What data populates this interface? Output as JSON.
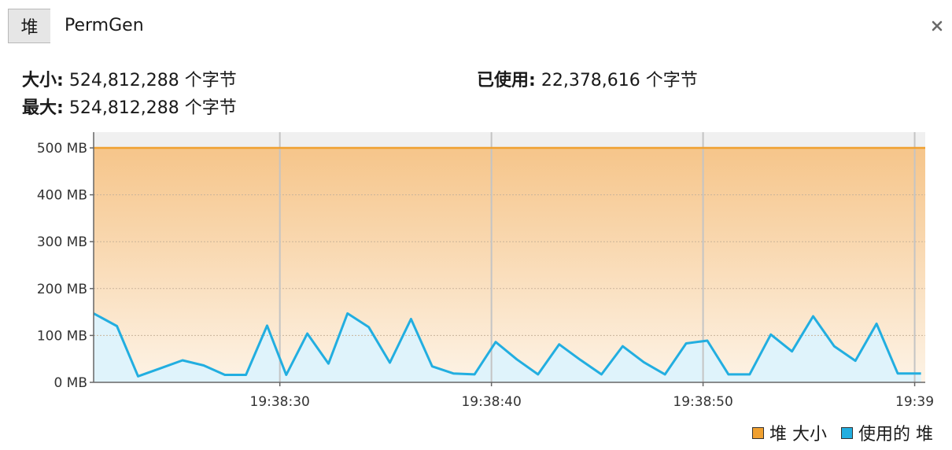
{
  "tabs": [
    {
      "label": "堆"
    },
    {
      "label": "PermGen"
    }
  ],
  "close_icon": "close-icon",
  "summary": {
    "size_label": "大小",
    "size_value": "524,812,288 个字节",
    "max_label": "最大",
    "max_value": "524,812,288 个字节",
    "used_label": "已使用",
    "used_value": "22,378,616 个字节",
    "separator": ":"
  },
  "colors": {
    "heap_size": "#f0a030",
    "used_heap": "#22aee0"
  },
  "chart_data": {
    "type": "area",
    "ylim": [
      0,
      500
    ],
    "y_ticks": [
      "0 MB",
      "100 MB",
      "200 MB",
      "300 MB",
      "400 MB",
      "500 MB"
    ],
    "y_tick_values": [
      0,
      100,
      200,
      300,
      400,
      500
    ],
    "x_tick_labels": [
      "19:38:30",
      "19:38:40",
      "19:38:50",
      "19:39"
    ],
    "x_tick_seconds": [
      30,
      40,
      50,
      60
    ],
    "xlim_seconds": [
      21.2,
      60.5
    ],
    "grid": true,
    "legend_position": "bottom-right",
    "series": [
      {
        "name": "堆 大小",
        "color": "#f0a030",
        "values_mb": [
          500,
          500
        ]
      },
      {
        "name": "使用的 堆",
        "color": "#22aee0",
        "points": [
          [
            21.2,
            147
          ],
          [
            22.3,
            120
          ],
          [
            23.3,
            13
          ],
          [
            24.3,
            29
          ],
          [
            25.4,
            47
          ],
          [
            26.4,
            36
          ],
          [
            27.4,
            16
          ],
          [
            28.4,
            16
          ],
          [
            29.4,
            121
          ],
          [
            30.3,
            16
          ],
          [
            31.3,
            104
          ],
          [
            32.3,
            40
          ],
          [
            33.2,
            147
          ],
          [
            34.2,
            118
          ],
          [
            35.2,
            42
          ],
          [
            36.2,
            135
          ],
          [
            37.2,
            34
          ],
          [
            38.2,
            19
          ],
          [
            39.2,
            17
          ],
          [
            40.2,
            86
          ],
          [
            41.2,
            49
          ],
          [
            42.2,
            17
          ],
          [
            43.2,
            81
          ],
          [
            44.2,
            48
          ],
          [
            45.2,
            17
          ],
          [
            46.2,
            77
          ],
          [
            47.2,
            43
          ],
          [
            48.2,
            17
          ],
          [
            49.2,
            83
          ],
          [
            50.2,
            89
          ],
          [
            51.2,
            17
          ],
          [
            52.2,
            17
          ],
          [
            53.2,
            102
          ],
          [
            54.2,
            66
          ],
          [
            55.2,
            141
          ],
          [
            56.2,
            77
          ],
          [
            57.2,
            46
          ],
          [
            58.2,
            125
          ],
          [
            59.2,
            19
          ],
          [
            60.3,
            19
          ]
        ]
      }
    ]
  }
}
